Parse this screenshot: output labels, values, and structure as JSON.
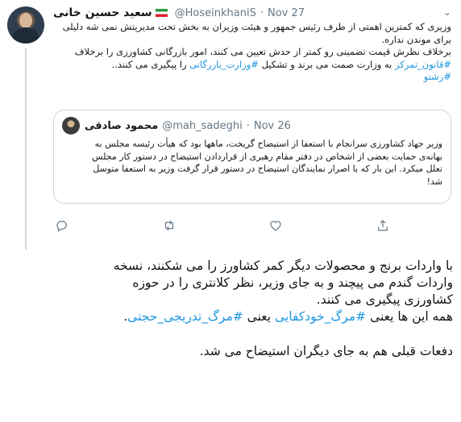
{
  "tweet": {
    "author_name": "سعید حسین خانی",
    "handle": "@HoseinkhaniS",
    "separator": "·",
    "date": "Nov 27",
    "lines": [
      "وزیری که کمترین اهمتی از طرف رئیس جمهور و هیئت وزیران به بخش تحت مدیریتش نمی شه دلیلی",
      "برای موندن نداره.",
      "برخلاف نظرش قیمت تضمینی رو کمتر از حدش تعیین می کنند، امور بازرگانی کشاورزی را برخلاف",
      "#قانون_تمرکز به وزارت صمت می برند و تشکیل #وزارت_بازرگانی را پیگیری می کنند.."
    ],
    "hashtag_1": "#قانون_تمرکز",
    "line4_mid": " به وزارت صمت می برند و تشکیل ",
    "hashtag_2": "#وزارت_بازرگانی",
    "line4_end": " را پیگیری می کنند..",
    "hashtag_3": "#رشتو"
  },
  "quote": {
    "author_name": "محمود صادقی",
    "handle": "@mah_sadeghi",
    "separator": "·",
    "date": "Nov 26",
    "lines": [
      "وزیر جهاد کشاورزی سرانجام با استعفا از استیضاح گریخت، ماهها بود که هیأت رئیسه مجلس به",
      "بهانه‌ی حمایت بعضی از اشخاص در دفتر مقام رهبری از قراردادن استیضاح در دستور کار مجلس",
      "تعلل میکرد. این بار که با اصرار نمایندگان استیضاح در دستور قرار گرفت وزیر به استعفا متوسل",
      "شد!"
    ]
  },
  "actions": [
    "reply-icon",
    "retweet-icon",
    "like-icon",
    "share-icon"
  ],
  "caption": {
    "lines": [
      "با واردات برنج و محصولات دیگر کمر کشاورز را می شکنند، نسخه",
      "واردات گندم می پیچند و به جای وزیر، نظر کلانتری را در حوزه",
      "کشاورزی پیگیری می کنند."
    ],
    "line4_start": "همه این ها یعنی ",
    "hashtag_a": "#مرگ_خودکفایی",
    "line4_mid": " یعنی ",
    "hashtag_b": "#مرگ_تدریجی_حجتی",
    "line4_end": ".",
    "last_line": "دفعات قبلی هم به جای دیگران استیضاح می شد."
  },
  "colors": {
    "link": "#1b95e0",
    "muted": "#657786",
    "border": "#ccd6dd"
  }
}
